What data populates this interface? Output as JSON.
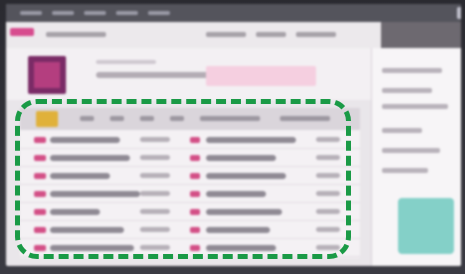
{
  "window": {
    "title": ""
  },
  "menu": {
    "items": [
      "",
      "",
      "",
      "",
      ""
    ]
  },
  "table": {
    "rows": 7
  },
  "annotation": {
    "style": "dashed-rounded-rectangle",
    "color": "#1a9a46"
  },
  "colors": {
    "accent": "#d34f86",
    "avatar": "#7a2b66",
    "selected_header": "#e0b13a",
    "side_card": "#84d0c8"
  }
}
